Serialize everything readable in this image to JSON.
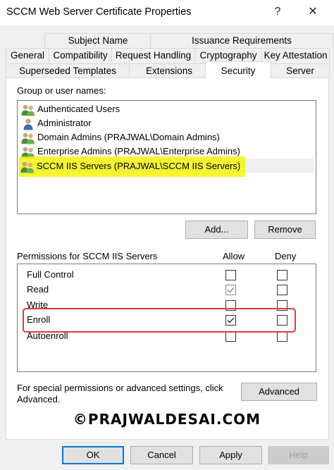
{
  "window": {
    "title": "SCCM Web Server Certificate Properties",
    "help_glyph": "?",
    "close_glyph": "✕"
  },
  "tabs": {
    "row1": [
      "Subject Name",
      "Issuance Requirements"
    ],
    "row2": [
      "General",
      "Compatibility",
      "Request Handling",
      "Cryptography",
      "Key Attestation"
    ],
    "row3": [
      "Superseded Templates",
      "Extensions",
      "Security",
      "Server"
    ],
    "active": "Security"
  },
  "security": {
    "group_label": "Group or user names:",
    "users": [
      {
        "name": "Authenticated Users",
        "icon": "group-icon"
      },
      {
        "name": "Administrator",
        "icon": "user-icon"
      },
      {
        "name": "Domain Admins (PRAJWAL\\Domain Admins)",
        "icon": "group-icon"
      },
      {
        "name": "Enterprise Admins (PRAJWAL\\Enterprise Admins)",
        "icon": "group-icon"
      },
      {
        "name": "SCCM IIS Servers (PRAJWAL\\SCCM IIS Servers)",
        "icon": "group-icon",
        "selected": true
      }
    ],
    "add_label": "Add...",
    "remove_label": "Remove",
    "perm_label": "Permissions for SCCM IIS Servers",
    "allow_label": "Allow",
    "deny_label": "Deny",
    "permissions": [
      {
        "name": "Full Control",
        "allow": false,
        "deny": false
      },
      {
        "name": "Read",
        "allow": true,
        "deny": false
      },
      {
        "name": "Write",
        "allow": false,
        "deny": false
      },
      {
        "name": "Enroll",
        "allow": true,
        "deny": false
      },
      {
        "name": "Autoenroll",
        "allow": false,
        "deny": false
      }
    ],
    "advanced_text": "For special permissions or advanced settings, click Advanced.",
    "advanced_label": "Advanced"
  },
  "watermark": "©PRAJWALDESAI.COM",
  "footer": {
    "ok": "OK",
    "cancel": "Cancel",
    "apply": "Apply",
    "help": "Help"
  }
}
